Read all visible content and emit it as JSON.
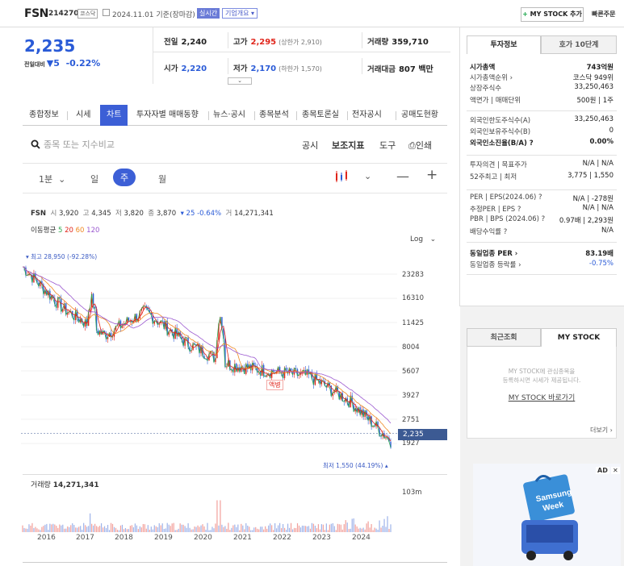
{
  "header": {
    "name": "FSN",
    "code": "214270",
    "market": "코스닥",
    "date": "2024.11.01 기준(장마감)",
    "live_badge": "실시간",
    "overview": "기업개요",
    "mystock_add": "MY STOCK 추가",
    "quick_order": "빠른주문"
  },
  "price": {
    "current": "2,235",
    "change_label": "전일대비",
    "change": "5",
    "change_pct": "-0.22%"
  },
  "stats": {
    "prev_label": "전일",
    "prev": "2,240",
    "high_label": "고가",
    "high": "2,295",
    "high_limit": "(상한가 2,910)",
    "volume_label": "거래량",
    "volume": "359,710",
    "open_label": "시가",
    "open": "2,220",
    "low_label": "저가",
    "low": "2,170",
    "low_limit": "(하한가 1,570)",
    "amount_label": "거래대금",
    "amount": "807 백만"
  },
  "nav": {
    "tabs": [
      "종합정보",
      "시세",
      "차트",
      "투자자별 매매동향",
      "뉴스·공시",
      "종목분석",
      "종목토론실",
      "전자공시",
      "공매도현황"
    ],
    "active": "차트"
  },
  "toolbar": {
    "search_placeholder": "종목 또는 지수비교",
    "disclosure": "공시",
    "indicator": "보조지표",
    "tools": "도구",
    "print": "인쇄"
  },
  "periods": {
    "minute": "1분",
    "day": "일",
    "week": "주",
    "month": "월",
    "active": "주"
  },
  "chart": {
    "info_name": "FSN",
    "info_open_label": "시",
    "info_open": "3,920",
    "info_high_label": "고",
    "info_high": "4,345",
    "info_low_label": "저",
    "info_low": "3,820",
    "info_close_label": "종",
    "info_close": "3,870",
    "info_change": "▾ 25 -0.64%",
    "info_vol_label": "거",
    "info_vol": "14,271,341",
    "ma_label": "이동평균",
    "ma_periods": [
      "5",
      "20",
      "60",
      "120"
    ],
    "scale": "Log",
    "max_label": "▾ 최고 28,950 (-92.28%)",
    "min_label": "최저 1,550 (44.19%) ▴",
    "split_label": "액병",
    "current_tag": "2,235",
    "volume_label": "거래량",
    "volume_value": "14,271,341",
    "volume_axis": "103m"
  },
  "chart_data": {
    "type": "line",
    "scale": "log",
    "y_ticks": [
      23283,
      16310,
      11425,
      8004,
      5607,
      3927,
      2751,
      1927
    ],
    "x": [
      2016,
      2017,
      2018,
      2019,
      2020,
      2021,
      2022,
      2023,
      2024
    ],
    "series": [
      {
        "name": "",
        "values": [
          26000,
          14000,
          9500,
          13500,
          8500,
          6200,
          5600,
          5200,
          3600,
          2000
        ]
      }
    ],
    "ma_colors": {
      "5": "#2fa84f",
      "20": "#e0251b",
      "60": "#f08a24",
      "120": "#9b59d0"
    },
    "max": 28950,
    "min": 1550,
    "current": 2235,
    "volume_max": "103m"
  },
  "side": {
    "tab_info": "투자정보",
    "tab_quote": "호가 10단계",
    "rows": [
      {
        "k": "시가총액",
        "v": "743억원",
        "bold": true
      },
      {
        "k": "시가총액순위 ›",
        "v": "코스닥 949위"
      },
      {
        "k": "상장주식수",
        "v": "33,250,463"
      },
      {
        "k": "액면가 | 매매단위",
        "v": "500원 | 1주"
      },
      {
        "k": "외국인한도주식수(A)",
        "v": "33,250,463"
      },
      {
        "k": "외국인보유주식수(B)",
        "v": "0"
      },
      {
        "k": "외국인소진율(B/A) ?",
        "v": "0.00%",
        "bold": true
      },
      {
        "k": "투자의견 | 목표주가",
        "v": "N/A | N/A"
      },
      {
        "k": "52주최고 | 최저",
        "v": "3,775 | 1,550"
      },
      {
        "k": "PER | EPS(2024.06) ?",
        "v": "N/A | -278원"
      },
      {
        "k": "추정PER | EPS ?",
        "v": "N/A | N/A"
      },
      {
        "k": "PBR | BPS (2024.06) ?",
        "v": "0.97배 | 2,293원"
      },
      {
        "k": "배당수익률 ?",
        "v": "N/A"
      },
      {
        "k": "동일업종 PER ›",
        "v": "83.19배",
        "bold": true
      },
      {
        "k": "동일업종 등락률 ›",
        "v": "-0.75%",
        "blue": true
      }
    ],
    "recent_tab": "최근조회",
    "mystock_tab": "MY STOCK",
    "mystock_msg1": "MY STOCK에 관심종목을",
    "mystock_msg2": "등록하시면 시세가 제공됩니다.",
    "mystock_link": "MY STOCK 바로가기",
    "more": "더보기 ›",
    "ad_label": "AD",
    "ad_close": "✕",
    "ad_text": "Samsung Week"
  }
}
